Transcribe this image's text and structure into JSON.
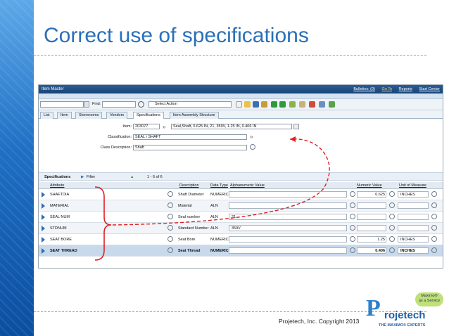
{
  "slide": {
    "title": "Correct use of specifications",
    "copyright": "Projetech, Inc. Copyright 2013",
    "logo": {
      "letter": "P",
      "word": "rojetech",
      "tagline": "THE MAXIMO® EXPERTS",
      "badge_line1": "Maximo®",
      "badge_line2": "as a Service"
    }
  },
  "app": {
    "window_title": "Item Master",
    "top_links": [
      "Bulletins: (0)",
      "Go To",
      "Reports",
      "Start Center"
    ],
    "toolbar": {
      "find_label": "Find:",
      "select_action": "Select Action"
    },
    "tabs": [
      "List",
      "Item",
      "Storerooms",
      "Vendors",
      "Specifications",
      "Item Assembly Structure"
    ],
    "active_tab": "Specifications",
    "form": {
      "item_label": "Item:",
      "item_value": "203077",
      "item_description": "Seal,Shaft, 0.625 IN, 21, 359V, 1.25 IN, 0.406 IN",
      "classification_label": "Classification:",
      "classification_value": "SEAL \\ SHAFT",
      "class_desc_label": "Class Description:",
      "class_desc_value": "Shaft"
    },
    "specs_section": {
      "label": "Specifications",
      "filter": "Filter",
      "paging": "1 - 6 of 6"
    },
    "columns": [
      "Attribute",
      "Description",
      "Data Type",
      "Alphanumeric Value",
      "Numeric Value",
      "Unit of Measure"
    ],
    "rows": [
      {
        "attribute": "SHAFTDIA",
        "description": "Shaft Diameter",
        "data_type": "NUMERIC",
        "alpha": "",
        "numeric": "0.625",
        "uom": "INCHES"
      },
      {
        "attribute": "MATERIAL",
        "description": "Material",
        "data_type": "ALN",
        "alpha": "",
        "numeric": "",
        "uom": ""
      },
      {
        "attribute": "SEAL NUM",
        "description": "Seal number",
        "data_type": "ALN",
        "alpha": "21",
        "numeric": "",
        "uom": ""
      },
      {
        "attribute": "STDNUM",
        "description": "Standard Number",
        "data_type": "ALN",
        "alpha": "359V",
        "numeric": "",
        "uom": ""
      },
      {
        "attribute": "SEAT BORE",
        "description": "Seat Bore",
        "data_type": "NUMERIC",
        "alpha": "",
        "numeric": "1.25",
        "uom": "INCHES"
      },
      {
        "attribute": "SEAT THREAD",
        "description": "Seat Thread",
        "data_type": "NUMERIC",
        "alpha": "",
        "numeric": "0.406",
        "uom": "INCHES"
      }
    ]
  },
  "colors": {
    "accent_title": "#2a6fb8",
    "annotation_red": "#e02020",
    "header_blue": "#184477"
  }
}
